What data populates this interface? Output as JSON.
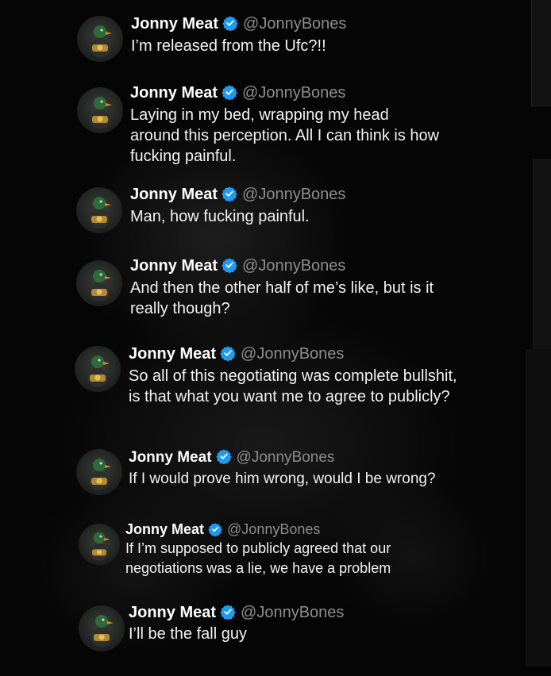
{
  "author": {
    "name": "Jonny Meat",
    "handle": "@JonnyBones",
    "verified_color": "#1d9bf0"
  },
  "tweets": [
    {
      "text": "I’m released from the Ufc?!!"
    },
    {
      "text": "Laying in my bed, wrapping my head around this perception. All I can think is how fucking painful."
    },
    {
      "text": "Man, how fucking painful."
    },
    {
      "text": "And then the other half of me’s like, but is it really though?"
    },
    {
      "text": "So all of this negotiating was complete bullshit, is that what you want me to agree to publicly?"
    },
    {
      "text": "If I would prove him wrong, would I be wrong?"
    },
    {
      "text": "If I’m supposed to publicly agreed that our negotiations was a lie, we have a problem"
    },
    {
      "text": "I’ll be the fall guy"
    }
  ]
}
